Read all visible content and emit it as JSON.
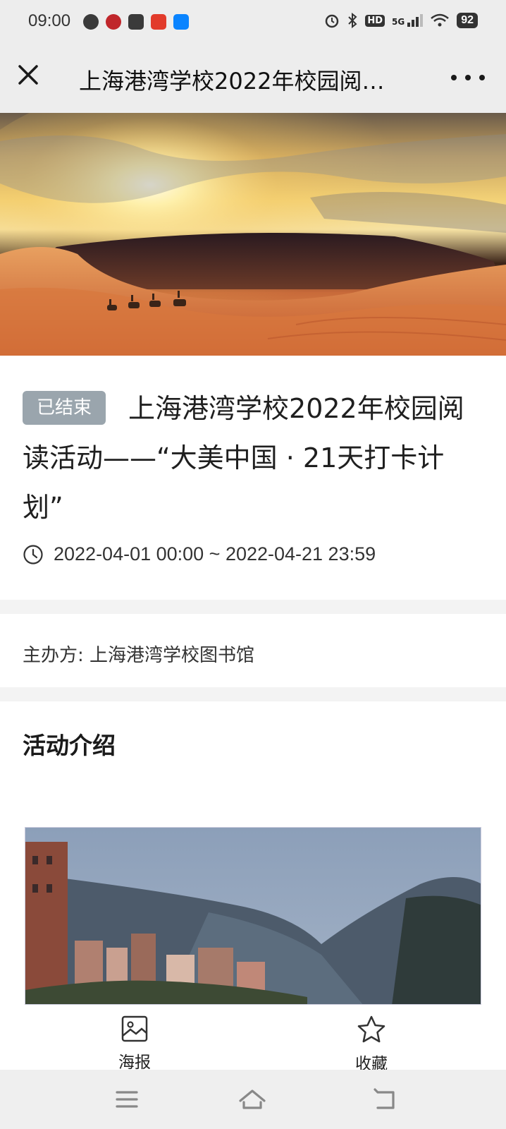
{
  "status_bar": {
    "time": "09:00",
    "network": "5G",
    "hd": "HD",
    "battery": "92",
    "app_icons": [
      "notification-icon",
      "railway-icon",
      "video-icon",
      "toutiao-icon",
      "zhihu-icon"
    ]
  },
  "nav": {
    "title": "上海港湾学校2022年校园阅…",
    "close_icon": "close-icon",
    "more_icon": "more-icon"
  },
  "event": {
    "status_badge": "已结束",
    "title": "上海港湾学校2022年校园阅读活动——“大美中国 · 21天打卡计划”",
    "time_range": "2022-04-01 00:00 ~ 2022-04-21 23:59"
  },
  "host": {
    "label": "主办方:",
    "name": "上海港湾学校图书馆"
  },
  "intro": {
    "heading": "活动介绍"
  },
  "actions": {
    "poster_label": "海报",
    "favorite_label": "收藏"
  },
  "colors": {
    "badge_bg": "#9aa5ad",
    "section_gap": "#f3f3f3",
    "bar_bg": "#ededed"
  }
}
